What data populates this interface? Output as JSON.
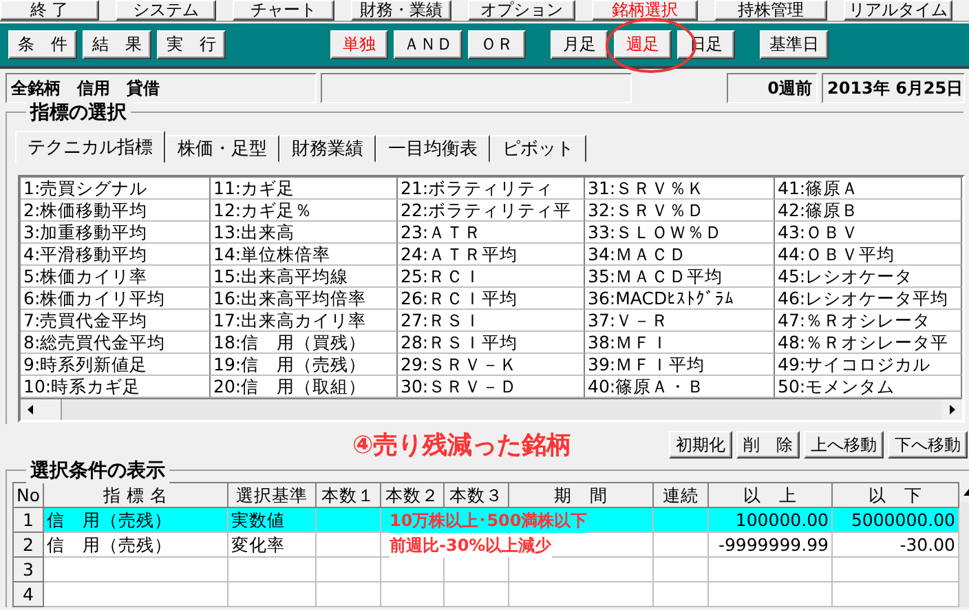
{
  "menu": [
    {
      "label": "終 了",
      "selected": false
    },
    {
      "label": "システム",
      "selected": false
    },
    {
      "label": "チャート",
      "selected": false
    },
    {
      "label": "財務・業績",
      "selected": false
    },
    {
      "label": "オプション",
      "selected": false
    },
    {
      "label": "銘柄選択",
      "selected": true
    },
    {
      "label": "持株管理",
      "selected": false
    },
    {
      "label": "リアルタイム",
      "selected": false
    }
  ],
  "toolbar": {
    "groups": [
      {
        "buttons": [
          {
            "label": "条　件",
            "selected": false
          },
          {
            "label": "結　果",
            "selected": false
          },
          {
            "label": "実　行",
            "selected": false
          }
        ]
      },
      {
        "buttons": [
          {
            "label": "単独",
            "selected": true
          },
          {
            "label": "ＡＮＤ",
            "selected": false
          },
          {
            "label": "ＯＲ",
            "selected": false
          }
        ]
      },
      {
        "buttons": [
          {
            "label": "月足",
            "selected": false
          },
          {
            "label": "週足",
            "selected": true,
            "circled": true
          },
          {
            "label": "日足",
            "selected": false
          }
        ]
      },
      {
        "buttons": [
          {
            "label": "基準日",
            "selected": false
          }
        ]
      }
    ]
  },
  "info": {
    "universe": "全銘柄　信用　貸借",
    "weeks_ago": "0週前",
    "date": "2013年  6月25日"
  },
  "indicator_panel": {
    "title": "指標の選択",
    "tabs": [
      {
        "label": "テクニカル指標",
        "selected": true
      },
      {
        "label": "株価・足型",
        "selected": false
      },
      {
        "label": "財務業績",
        "selected": false
      },
      {
        "label": "一目均衡表",
        "selected": false
      },
      {
        "label": "ピボット",
        "selected": false
      }
    ],
    "items": [
      "1:売買シグナル",
      "2:株価移動平均",
      "3:加重移動平均",
      "4:平滑移動平均",
      "5:株価カイリ率",
      "6:株価カイリ平均",
      "7:売買代金平均",
      "8:総売買代金平均",
      "9:時系列新値足",
      "10:時系カギ足",
      "11:カギ足",
      "12:カギ足％",
      "13:出来高",
      "14:単位株倍率",
      "15:出来高平均線",
      "16:出来高平均倍率",
      "17:出来高カイリ率",
      "18:信　用（買残）",
      "19:信　用（売残）",
      "20:信　用（取組）",
      "21:ボラティリティ",
      "22:ボラティリティ平",
      "23:ＡＴＲ",
      "24:ＡＴＲ平均",
      "25:ＲＣＩ",
      "26:ＲＣＩ平均",
      "27:ＲＳＩ",
      "28:ＲＳＩ平均",
      "29:ＳＲＶ－Ｋ",
      "30:ＳＲＶ－Ｄ",
      "31:ＳＲＶ％Ｋ",
      "32:ＳＲＶ％Ｄ",
      "33:ＳＬＯＷ％Ｄ",
      "34:ＭＡＣＤ",
      "35:ＭＡＣＤ平均",
      "36:MACDﾋｽﾄｸﾞﾗﾑ",
      "37:Ｖ－Ｒ",
      "38:ＭＦＩ",
      "39:ＭＦＩ平均",
      "40:篠原Ａ・Ｂ",
      "41:篠原Ａ",
      "42:篠原Ｂ",
      "43:ＯＢＶ",
      "44:ＯＢＶ平均",
      "45:レシオケータ",
      "46:レシオケータ平均",
      "47:％Ｒオシレータ",
      "48:％Ｒオシレータ平",
      "49:サイコロジカル",
      "50:モメンタム"
    ]
  },
  "annotation": "④売り残減った銘柄",
  "condition_buttons": [
    "初期化",
    "削　除",
    "上へ移動",
    "下へ移動"
  ],
  "conditions": {
    "title": "選択条件の表示",
    "columns": [
      "No",
      "指 標 名",
      "選択基準",
      "本数１",
      "本数２",
      "本数３",
      "期　間",
      "連続",
      "以　上",
      "以　下"
    ],
    "rows": [
      {
        "selected": true,
        "cells": [
          "1",
          "信　用（売残）",
          "実数値",
          "",
          "",
          "",
          "",
          "",
          "100000.00",
          "5000000.00"
        ],
        "note": "10万株以上･500満株以下"
      },
      {
        "selected": false,
        "cells": [
          "2",
          "信　用（売残）",
          "変化率",
          "",
          "",
          "",
          "",
          "",
          "-9999999.99",
          "-30.00"
        ],
        "note": "前週比-30%以上減少"
      },
      {
        "selected": false,
        "cells": [
          "3",
          "",
          "",
          "",
          "",
          "",
          "",
          "",
          "",
          ""
        ]
      },
      {
        "selected": false,
        "cells": [
          "4",
          "",
          "",
          "",
          "",
          "",
          "",
          "",
          "",
          ""
        ]
      }
    ]
  }
}
